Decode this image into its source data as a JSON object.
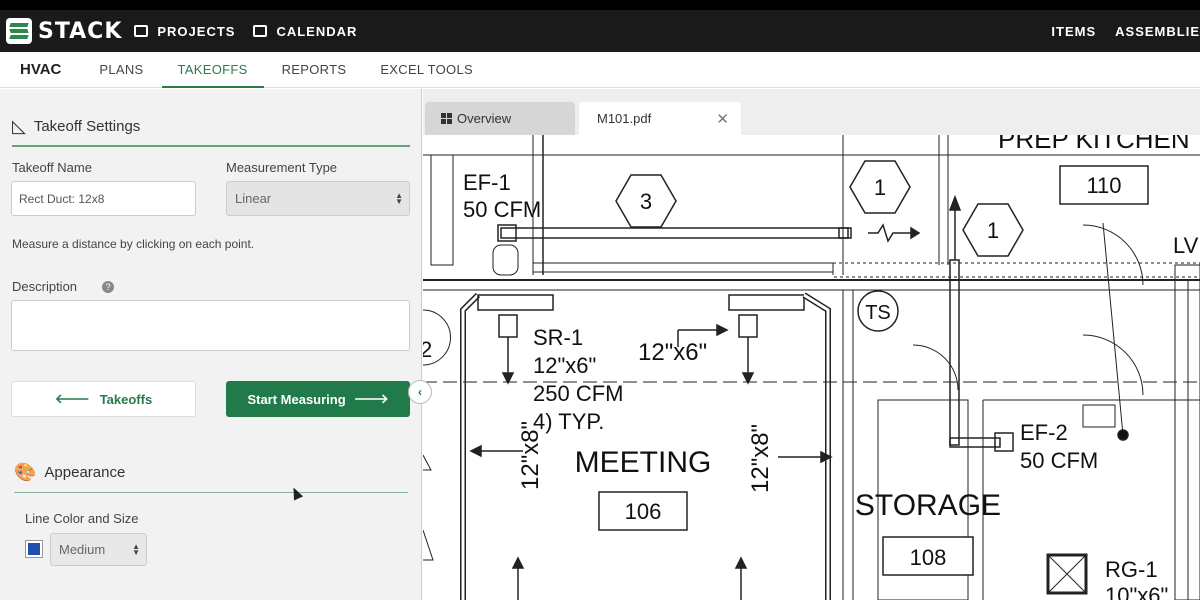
{
  "brand": {
    "name": "STACK"
  },
  "topnav": {
    "projects": "PROJECTS",
    "calendar": "CALENDAR",
    "items": "ITEMS",
    "assemblies": "ASSEMBLIE"
  },
  "subnav": {
    "project": "HVAC",
    "plans": "PLANS",
    "takeoffs": "TAKEOFFS",
    "reports": "REPORTS",
    "excel": "EXCEL TOOLS"
  },
  "panel": {
    "settings_title": "Takeoff Settings",
    "name_label": "Takeoff Name",
    "name_value": "Rect Duct: 12x8",
    "type_label": "Measurement Type",
    "type_value": "Linear",
    "hint": "Measure a distance by clicking on each point.",
    "description_label": "Description",
    "description_help": "?",
    "back_button": "Takeoffs",
    "start_button": "Start Measuring",
    "appearance_title": "Appearance",
    "line_label": "Line Color and Size",
    "line_size": "Medium",
    "line_color": "#1f4fb0"
  },
  "viewer": {
    "tab_overview": "Overview",
    "tab_file": "M101.pdf",
    "plan": {
      "ef1": "EF-1",
      "ef1_cfm": "50 CFM",
      "hex3": "3",
      "hex1a": "1",
      "hex1b": "1",
      "room110": "110",
      "prep": "PREP KITCHEN",
      "lv": "LV",
      "ts": "TS",
      "sr1": "SR-1",
      "sr1_size": "12\"x6\"",
      "sr1_cfm": "250 CFM",
      "sr1_typ": "4) TYP.",
      "duct_top": "12\"x6\"",
      "duct_left": "12\"x8\"",
      "duct_right": "12\"x8\"",
      "meeting": "MEETING",
      "room106": "106",
      "ef2": "EF-2",
      "ef2_cfm": "50 CFM",
      "storage": "STORAGE",
      "room108": "108",
      "rg1": "RG-1",
      "rg1_size": "10\"x6\"",
      "left_2": "2"
    }
  }
}
